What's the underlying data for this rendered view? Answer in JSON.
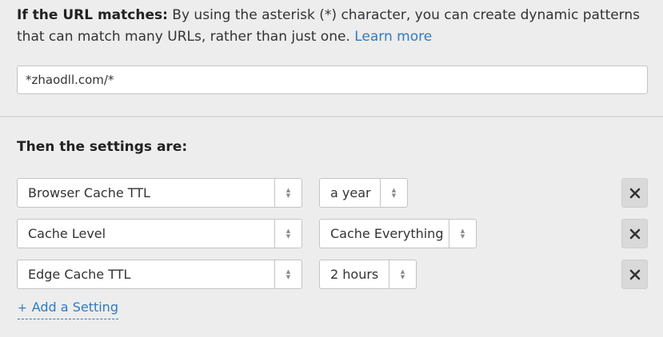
{
  "rule": {
    "heading": "If the URL matches:",
    "description": " By using the asterisk (*) character, you can create dynamic patterns that can match many URLs, rather than just one. ",
    "learn_more": "Learn more",
    "url_pattern": "*zhaodll.com/*"
  },
  "settings_title": "Then the settings are:",
  "settings": [
    {
      "name": "Browser Cache TTL",
      "value": "a year"
    },
    {
      "name": "Cache Level",
      "value": "Cache Everything"
    },
    {
      "name": "Edge Cache TTL",
      "value": "2 hours"
    }
  ],
  "add_setting": {
    "icon": "+",
    "label": "Add a Setting"
  },
  "colors": {
    "link": "#2f7bbf",
    "background": "#ecedec"
  }
}
